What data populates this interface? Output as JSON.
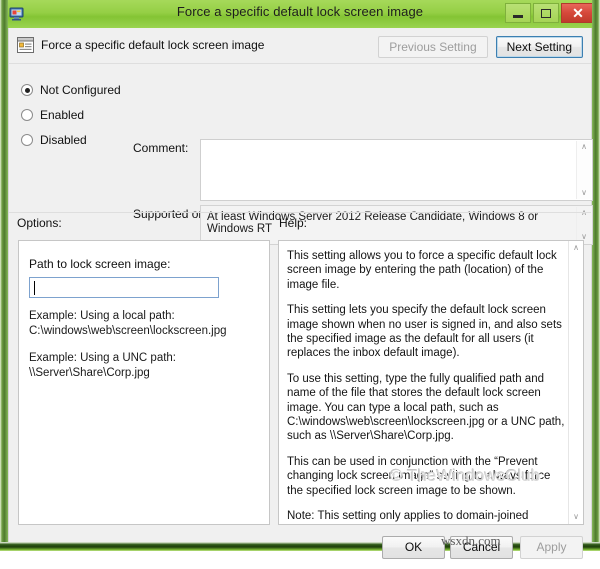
{
  "window": {
    "title": "Force a specific default lock screen image",
    "icon": "group-policy-monitor-icon",
    "minimize_label": "–",
    "maximize_label": "□",
    "close_label": "✕"
  },
  "header": {
    "setting_name": "Force a specific default lock screen image",
    "icon": "policy-setting-icon",
    "previous_setting_label": "Previous Setting",
    "next_setting_label": "Next Setting",
    "previous_setting_enabled": false,
    "next_setting_enabled": true
  },
  "state": {
    "options": [
      {
        "label": "Not Configured",
        "selected": true
      },
      {
        "label": "Enabled",
        "selected": false
      },
      {
        "label": "Disabled",
        "selected": false
      }
    ],
    "comment_label": "Comment:",
    "comment_value": "",
    "supported_label": "Supported on:",
    "supported_value": "At least Windows Server 2012 Release Candidate, Windows 8 or Windows RT"
  },
  "panels": {
    "options_label": "Options:",
    "help_label": "Help:"
  },
  "options": {
    "path_label": "Path to lock screen image:",
    "path_value": "",
    "example_local_title": "Example: Using a local path:",
    "example_local_path": "C:\\windows\\web\\screen\\lockscreen.jpg",
    "example_unc_title": "Example: Using a UNC path:",
    "example_unc_path": "\\\\Server\\Share\\Corp.jpg"
  },
  "help": {
    "paragraphs": [
      "This setting allows you to force a specific default lock screen image by entering the path (location) of the image file.",
      "This setting lets you specify the default lock screen image shown when no user is signed in, and also sets the specified image as the default for all users (it replaces the inbox default image).",
      "To use this setting, type the fully qualified path and name of the file that stores the default lock screen image. You can type a local path, such as C:\\windows\\web\\screen\\lockscreen.jpg or a UNC path, such as \\\\Server\\Share\\Corp.jpg.",
      "This can be used in conjunction with the “Prevent changing lock screen image” setting to always force the specified lock screen image to be shown.",
      "Note: This setting only applies to domain-joined machines, or unconditionally in Enterprise and Server SKUs."
    ]
  },
  "scrollbar": {
    "up_arrow": "∧",
    "down_arrow": "∨"
  },
  "footer": {
    "ok_label": "OK",
    "cancel_label": "Cancel",
    "apply_label": "Apply",
    "apply_enabled": false
  },
  "watermarks": {
    "primary": "© TheWindowsClub",
    "secondary": "wsxdn.com"
  },
  "colors": {
    "window_frame_green": "#8bc63f",
    "titlebar_green": "#95cf45",
    "close_red": "#d5483a",
    "focus_blue": "#3c7fb1",
    "client_bg": "#f0f0f0"
  }
}
